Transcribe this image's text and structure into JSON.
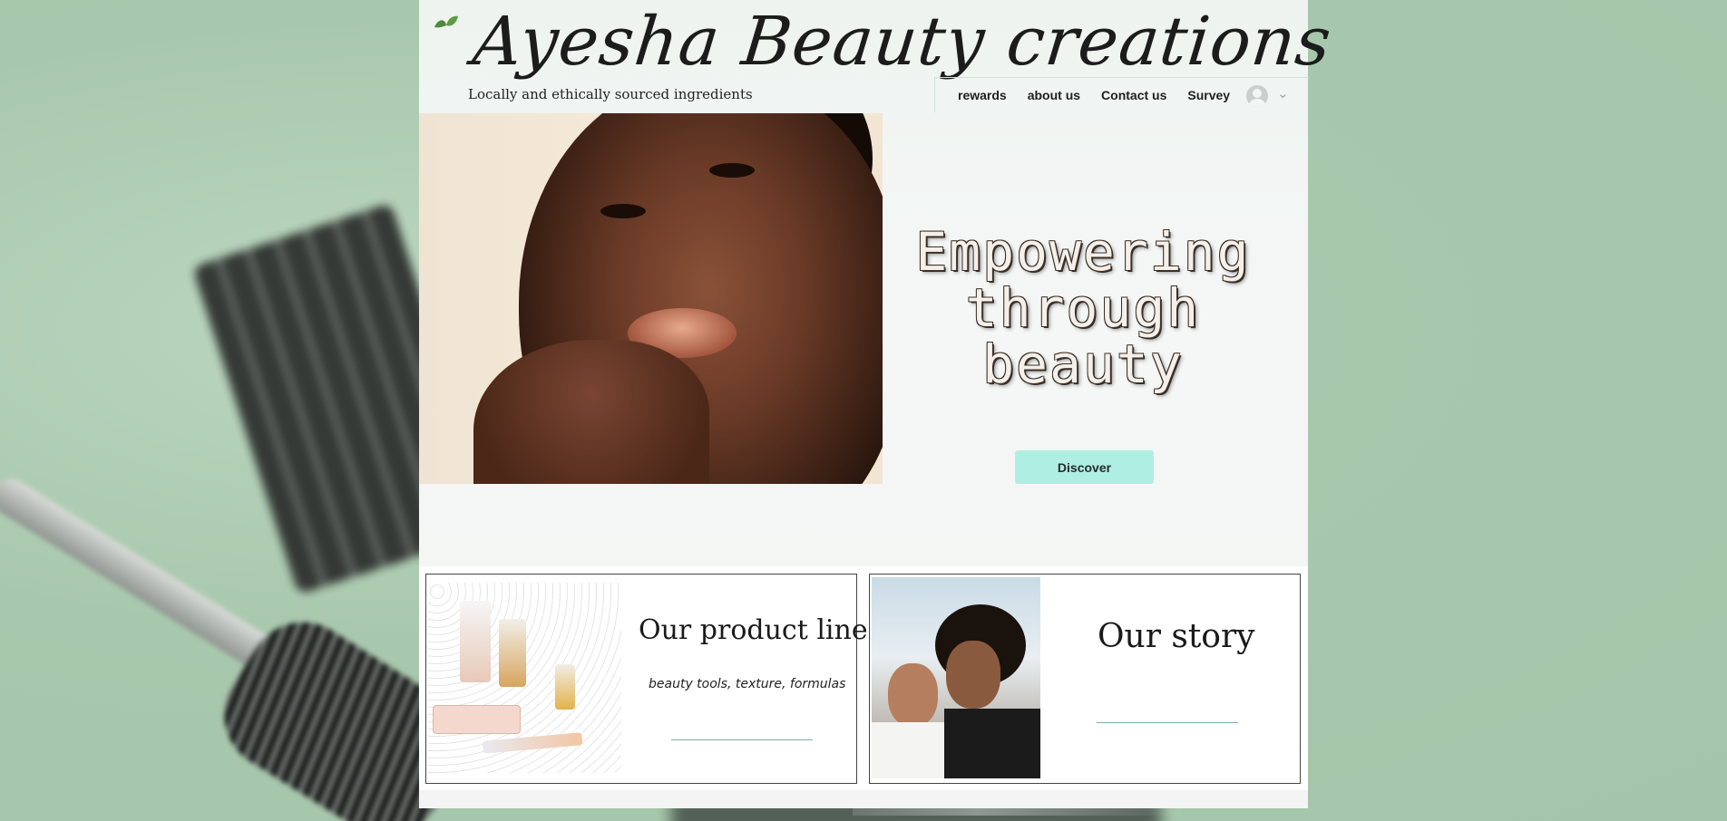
{
  "header": {
    "brand": "Ayesha Beauty creations",
    "tagline": "Locally and ethically sourced ingredients"
  },
  "nav": {
    "items": [
      {
        "label": "rewards"
      },
      {
        "label": "about us"
      },
      {
        "label": "Contact us"
      },
      {
        "label": "Survey"
      }
    ]
  },
  "hero": {
    "headline": "Empowering through beauty",
    "cta_label": "Discover"
  },
  "cards": [
    {
      "title": "Our product line",
      "subtitle": "beauty tools, texture, formulas"
    },
    {
      "title": "Our story"
    }
  ],
  "colors": {
    "accent": "#aeeee3",
    "background": "#a9c9ae",
    "text": "#1c1c1c"
  }
}
